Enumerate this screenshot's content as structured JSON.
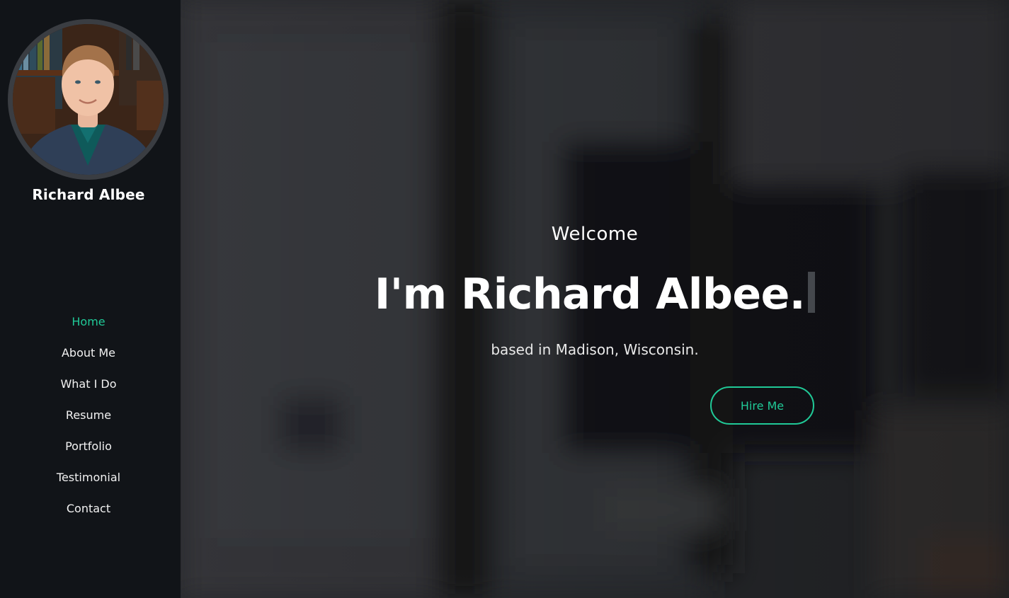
{
  "sidebar": {
    "owner_name": "Richard Albee",
    "nav": [
      {
        "label": "Home",
        "active": true
      },
      {
        "label": "About Me",
        "active": false
      },
      {
        "label": "What I Do",
        "active": false
      },
      {
        "label": "Resume",
        "active": false
      },
      {
        "label": "Portfolio",
        "active": false
      },
      {
        "label": "Testimonial",
        "active": false
      },
      {
        "label": "Contact",
        "active": false
      }
    ]
  },
  "hero": {
    "welcome": "Welcome",
    "headline": "I'm Richard Albee.",
    "location": "based in Madison, Wisconsin.",
    "cta_label": "Hire Me"
  },
  "colors": {
    "accent": "#20c997",
    "sidebar_bg": "#111418",
    "text": "#ffffff"
  }
}
